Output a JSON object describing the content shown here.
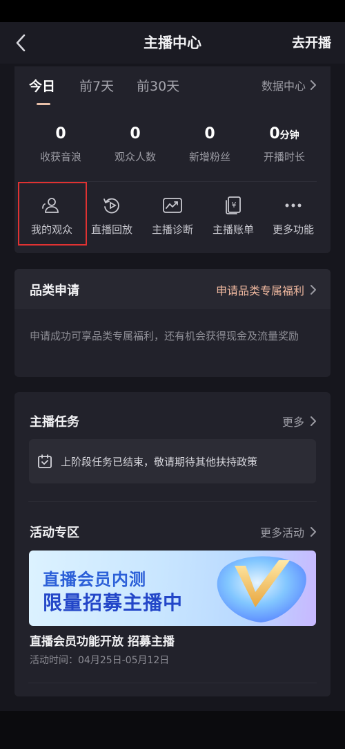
{
  "header": {
    "title": "主播中心",
    "start_live": "去开播"
  },
  "overview": {
    "tabs": [
      {
        "label": "今日",
        "active": true
      },
      {
        "label": "前7天",
        "active": false
      },
      {
        "label": "前30天",
        "active": false
      }
    ],
    "data_center": "数据中心",
    "stats": [
      {
        "value": "0",
        "unit": "",
        "label": "收获音浪"
      },
      {
        "value": "0",
        "unit": "",
        "label": "观众人数"
      },
      {
        "value": "0",
        "unit": "",
        "label": "新增粉丝"
      },
      {
        "value": "0",
        "unit": "分钟",
        "label": "开播时长"
      }
    ],
    "features": [
      {
        "label": "我的观众",
        "icon": "audience-icon"
      },
      {
        "label": "直播回放",
        "icon": "replay-icon"
      },
      {
        "label": "主播诊断",
        "icon": "diagnosis-icon"
      },
      {
        "label": "主播账单",
        "icon": "bill-icon"
      },
      {
        "label": "更多功能",
        "icon": "more-icon"
      }
    ]
  },
  "category": {
    "title": "品类申请",
    "link": "申请品类专属福利",
    "description": "申请成功可享品类专属福利，还有机会获得现金及流量奖励"
  },
  "tasks": {
    "title": "主播任务",
    "more": "更多",
    "notice": "上阶段任务已结束，敬请期待其他扶持政策"
  },
  "activities": {
    "title": "活动专区",
    "more": "更多活动",
    "banner_line1": "直播会员内测",
    "banner_line2": "限量招募主播中",
    "item_title": "直播会员功能开放 招募主播",
    "item_time": "活动时间：04月25日-05月12日"
  },
  "colors": {
    "accent": "#e8bfa8",
    "highlight": "#e03232",
    "background": "#16161d",
    "card": "#22222b"
  }
}
